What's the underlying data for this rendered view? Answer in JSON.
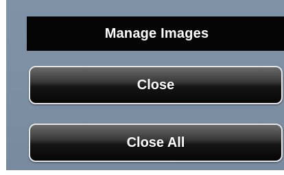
{
  "header": {
    "title": "Manage Images"
  },
  "buttons": {
    "close_label": "Close",
    "close_all_label": "Close All"
  },
  "colors": {
    "panel_background": "#7c8fa3",
    "header_background": "#050505",
    "button_border": "#e6e6e6",
    "text": "#ffffff"
  }
}
